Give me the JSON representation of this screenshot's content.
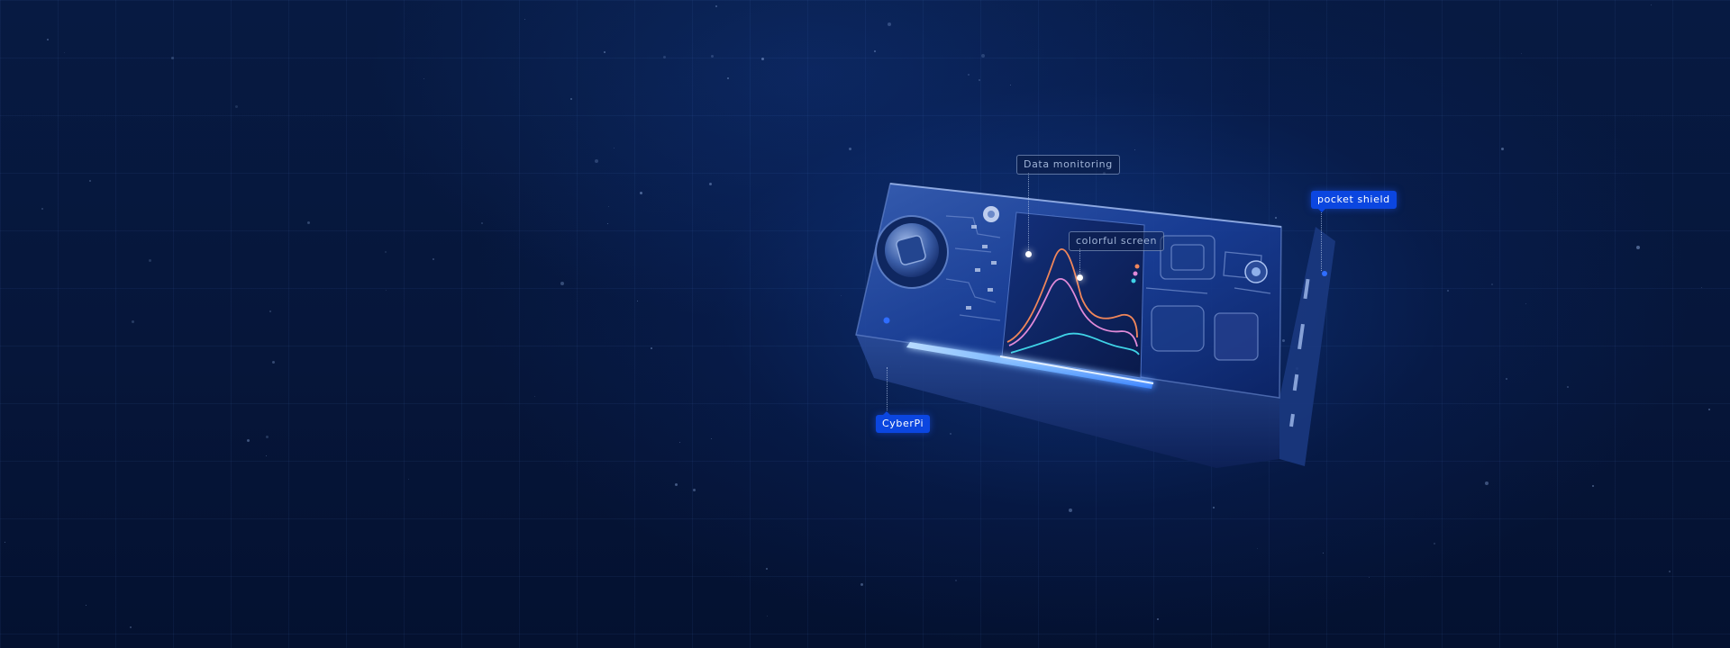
{
  "labels": {
    "data_monitoring": "Data monitoring",
    "colorful_screen": "colorful screen",
    "pocket_shield": "pocket shield",
    "cyberpi": "CyberPi"
  },
  "colors": {
    "background": "#06163a",
    "accent": "#0b46e0",
    "screen_curve_orange": "#f0865a",
    "screen_curve_pink": "#e08ad8",
    "screen_curve_cyan": "#3fd2e6",
    "light_bar": "#8fc2ff"
  },
  "icons": {
    "joystick": "joystick-icon",
    "usb_port": "usb-c-port-icon",
    "speaker": "speaker-grille-icon"
  }
}
